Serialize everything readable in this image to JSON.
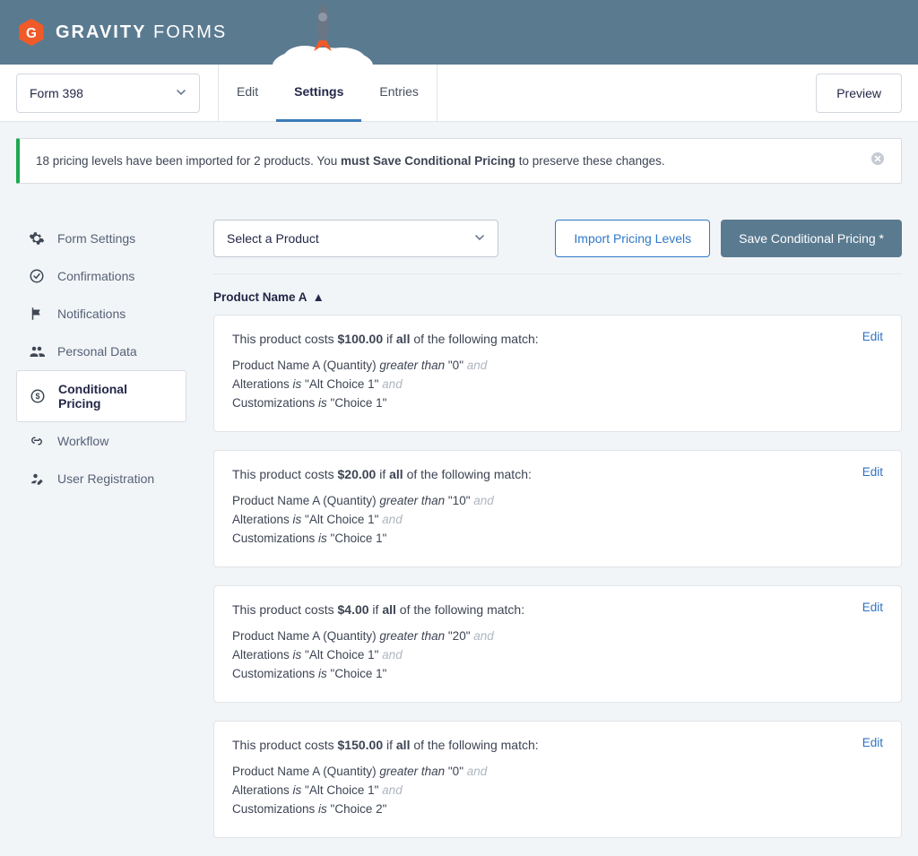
{
  "header": {
    "logo_text_bold": "GRAVITY",
    "logo_text_light": " FORMS"
  },
  "nav": {
    "form_selector": "Form 398",
    "tabs": [
      "Edit",
      "Settings",
      "Entries"
    ],
    "active_tab": "Settings",
    "preview": "Preview"
  },
  "notice": {
    "pre": "18 pricing levels have been imported for 2 products. You ",
    "bold": "must Save Conditional Pricing",
    "post": " to preserve these changes."
  },
  "sidebar": {
    "items": [
      {
        "label": "Form Settings",
        "icon": "gear"
      },
      {
        "label": "Confirmations",
        "icon": "check-circle"
      },
      {
        "label": "Notifications",
        "icon": "flag"
      },
      {
        "label": "Personal Data",
        "icon": "people"
      },
      {
        "label": "Conditional Pricing",
        "icon": "dollar",
        "active": true
      },
      {
        "label": "Workflow",
        "icon": "link"
      },
      {
        "label": "User Registration",
        "icon": "person-edit"
      }
    ]
  },
  "panel": {
    "select_placeholder": "Select a Product",
    "import_btn": "Import Pricing Levels",
    "save_btn": "Save Conditional Pricing *",
    "product_group": "Product Name A",
    "rules": [
      {
        "price": "$100.00",
        "match": "all",
        "edit": "Edit",
        "conditions": [
          {
            "field": "Product Name A (Quantity)",
            "op": "greater than",
            "value": "\"0\""
          },
          {
            "field": "Alterations",
            "op": "is",
            "value": "\"Alt Choice 1\""
          },
          {
            "field": "Customizations",
            "op": "is",
            "value": "\"Choice 1\""
          }
        ]
      },
      {
        "price": "$20.00",
        "match": "all",
        "edit": "Edit",
        "conditions": [
          {
            "field": "Product Name A (Quantity)",
            "op": "greater than",
            "value": "\"10\""
          },
          {
            "field": "Alterations",
            "op": "is",
            "value": "\"Alt Choice 1\""
          },
          {
            "field": "Customizations",
            "op": "is",
            "value": "\"Choice 1\""
          }
        ]
      },
      {
        "price": "$4.00",
        "match": "all",
        "edit": "Edit",
        "conditions": [
          {
            "field": "Product Name A (Quantity)",
            "op": "greater than",
            "value": "\"20\""
          },
          {
            "field": "Alterations",
            "op": "is",
            "value": "\"Alt Choice 1\""
          },
          {
            "field": "Customizations",
            "op": "is",
            "value": "\"Choice 1\""
          }
        ]
      },
      {
        "price": "$150.00",
        "match": "all",
        "edit": "Edit",
        "conditions": [
          {
            "field": "Product Name A (Quantity)",
            "op": "greater than",
            "value": "\"0\""
          },
          {
            "field": "Alterations",
            "op": "is",
            "value": "\"Alt Choice 1\""
          },
          {
            "field": "Customizations",
            "op": "is",
            "value": "\"Choice 2\""
          }
        ]
      }
    ]
  }
}
